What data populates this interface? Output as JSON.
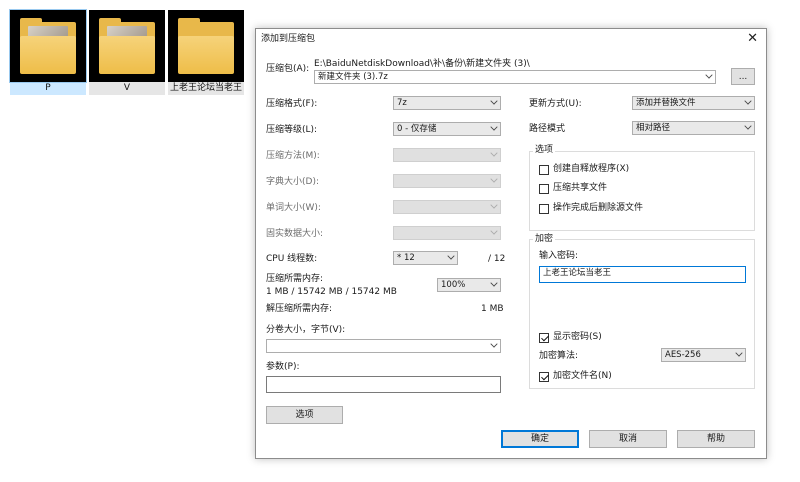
{
  "desktop": {
    "folders": [
      {
        "name": "P",
        "selected": true
      },
      {
        "name": "V",
        "selected": false
      },
      {
        "name": "上老王论坛当老王",
        "selected": false
      }
    ]
  },
  "dialog": {
    "title": "添加到压缩包",
    "close_glyph": "✕",
    "archive_label": "压缩包(A):",
    "archive_path": "E:\\BaiduNetdiskDownload\\补\\备份\\新建文件夹 (3)\\",
    "archive_name": "新建文件夹 (3).7z",
    "browse_label": "...",
    "format_label": "压缩格式(F):",
    "format_value": "7z",
    "level_label": "压缩等级(L):",
    "level_value": "0 - 仅存储",
    "method_label": "压缩方法(M):",
    "dict_label": "字典大小(D):",
    "word_label": "单词大小(W):",
    "solid_label": "固实数据大小:",
    "cpu_label": "CPU 线程数:",
    "cpu_value": "* 12",
    "cpu_max": "/ 12",
    "mem_comp_label": "压缩所需内存:",
    "mem_comp_value": "1 MB / 15742 MB / 15742 MB",
    "mem_percent": "100%",
    "mem_decomp_label": "解压缩所需内存:",
    "mem_decomp_value": "1 MB",
    "split_label": "分卷大小，字节(V):",
    "split_value": "",
    "params_label": "参数(P):",
    "params_value": "",
    "options_button": "选项",
    "update_label": "更新方式(U):",
    "update_value": "添加并替换文件",
    "pathmode_label": "路径模式",
    "pathmode_value": "相对路径",
    "options_group": {
      "title": "选项",
      "sfx": "创建自释放程序(X)",
      "shared": "压缩共享文件",
      "delete": "操作完成后删除源文件"
    },
    "encrypt_group": {
      "title": "加密",
      "password_label": "输入密码:",
      "password_value": "上老王论坛当老王",
      "show_password": "显示密码(S)",
      "method_label": "加密算法:",
      "method_value": "AES-256",
      "encrypt_names": "加密文件名(N)"
    },
    "ok_button": "确定",
    "cancel_button": "取消",
    "help_button": "帮助"
  }
}
